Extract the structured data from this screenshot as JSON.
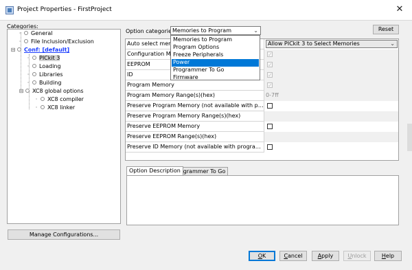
{
  "window": {
    "title": "Project Properties - FirstProject",
    "close_glyph": "✕"
  },
  "categories": {
    "label": "Categories:",
    "items": [
      {
        "label": "General"
      },
      {
        "label": "File Inclusion/Exclusion"
      },
      {
        "label": "Conf: [default]"
      },
      {
        "label": "PICkit 3"
      },
      {
        "label": "Loading"
      },
      {
        "label": "Libraries"
      },
      {
        "label": "Building"
      },
      {
        "label": "XC8 global options"
      },
      {
        "label": "XC8 compiler"
      },
      {
        "label": "XC8 linker"
      }
    ],
    "manage_label": "Manage Configurations..."
  },
  "options": {
    "label": "Option categories:",
    "selected": "Memories to Program",
    "reset_label": "Reset",
    "dropdown_items": [
      "Memories to Program",
      "Program Options",
      "Freeze Peripherals",
      "Power",
      "Programmer To Go",
      "Firmware"
    ],
    "dropdown_highlighted": "Power"
  },
  "grid": {
    "rows": [
      {
        "label": "Auto select memories",
        "value": "Allow PICkit 3 to Select Memories"
      },
      {
        "label": "Configuration Memory"
      },
      {
        "label": "EEPROM"
      },
      {
        "label": "ID"
      },
      {
        "label": "Program Memory"
      },
      {
        "label": "Program Memory Range(s)(hex)",
        "value": "0-7ff"
      },
      {
        "label": "Preserve Program Memory (not available with programmer t..."
      },
      {
        "label": "Preserve Program Memory Range(s)(hex)"
      },
      {
        "label": "Preserve EEPROM Memory"
      },
      {
        "label": "Preserve EEPROM Range(s)(hex)"
      },
      {
        "label": "Preserve ID Memory (not available with programmer to go)"
      }
    ]
  },
  "tabs": {
    "description": "Option Description",
    "programmer": "Programmer To Go"
  },
  "buttons": {
    "ok_prefix": "",
    "ok_mnemonic": "O",
    "ok_rest": "K",
    "cancel_prefix": "",
    "cancel_mnemonic": "C",
    "cancel_rest": "ancel",
    "apply_prefix": "",
    "apply_mnemonic": "A",
    "apply_rest": "pply",
    "unlock_prefix": "",
    "unlock_mnemonic": "U",
    "unlock_rest": "nlock",
    "help_prefix": "",
    "help_mnemonic": "H",
    "help_rest": "elp"
  },
  "colors": {
    "link": "#1a3cff",
    "highlight": "#0078d7"
  }
}
